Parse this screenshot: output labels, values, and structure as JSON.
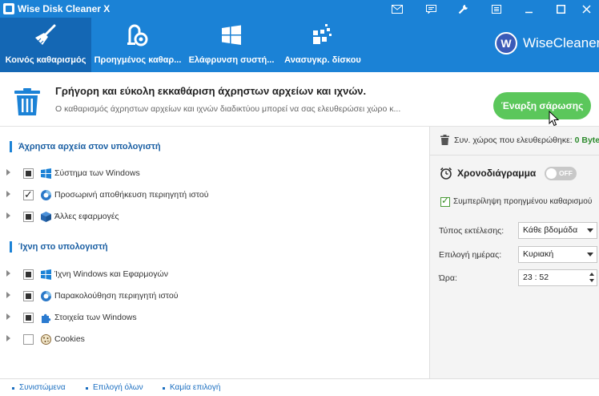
{
  "window": {
    "title": "Wise Disk Cleaner X"
  },
  "titlebar": {
    "icons": [
      "mail-icon",
      "chat-icon",
      "wrench-icon",
      "menu-icon",
      "minimize-icon",
      "maximize-icon",
      "close-icon"
    ]
  },
  "nav": {
    "tabs": [
      {
        "label": "Κοινός καθαρισμός",
        "icon": "broom-icon",
        "active": true
      },
      {
        "label": "Προηγμένος καθαρ...",
        "icon": "advanced-cleaner-icon",
        "active": false
      },
      {
        "label": "Ελάφρυνση συστή...",
        "icon": "windows-logo-icon",
        "active": false
      },
      {
        "label": "Ανασυγκρ. δίσκου",
        "icon": "defrag-icon",
        "active": false
      }
    ],
    "brand": {
      "logo_letter": "W",
      "name": "WiseCleaner"
    }
  },
  "banner": {
    "title": "Γρήγορη και εύκολη εκκαθάριση άχρηστων αρχείων και ιχνών.",
    "subtitle": "Ο καθαρισμός άχρηστων αρχείων και ιχνών διαδικτύου μπορεί να σας ελευθερώσει χώρο κ...",
    "scan_button": "Έναρξη σάρωσης"
  },
  "left": {
    "section1": {
      "title": "Άχρηστα αρχεία στον υπολογιστή",
      "items": [
        {
          "label": "Σύστημα των Windows",
          "state": "partial",
          "icon": "windows-icon"
        },
        {
          "label": "Προσωρινή αποθήκευση περιηγητή ιστού",
          "state": "checked",
          "icon": "browser-icon"
        },
        {
          "label": "Άλλες εφαρμογές",
          "state": "partial",
          "icon": "package-icon"
        }
      ]
    },
    "section2": {
      "title": "Ίχνη στο υπολογιστή",
      "items": [
        {
          "label": "Ίχνη Windows και Εφαρμογών",
          "state": "partial",
          "icon": "windows-icon"
        },
        {
          "label": "Παρακολούθηση περιηγητή ιστού",
          "state": "partial",
          "icon": "browser-icon"
        },
        {
          "label": "Στοιχεία των Windows",
          "state": "partial",
          "icon": "puzzle-icon"
        },
        {
          "label": "Cookies",
          "state": "unchecked",
          "icon": "cookie-icon"
        }
      ]
    }
  },
  "right": {
    "freed_label": "Συν. χώρος που ελευθερώθηκε:",
    "freed_value": "0 Bytes",
    "schedule_title": "Χρονοδιάγραμμα",
    "toggle_label": "OFF",
    "include_label": "Συμπερίληψη προηγμένου καθαρισμού",
    "run_type_label": "Τύπος εκτέλεσης:",
    "run_type_value": "Κάθε βδομάδα",
    "day_label": "Επιλογή ημέρας:",
    "day_value": "Κυριακή",
    "time_label": "Ώρα:",
    "time_value": "23 : 52"
  },
  "footer": {
    "recommended": "Συνιστώμενα",
    "select_all": "Επιλογή όλων",
    "select_none": "Καμία επιλογή"
  }
}
